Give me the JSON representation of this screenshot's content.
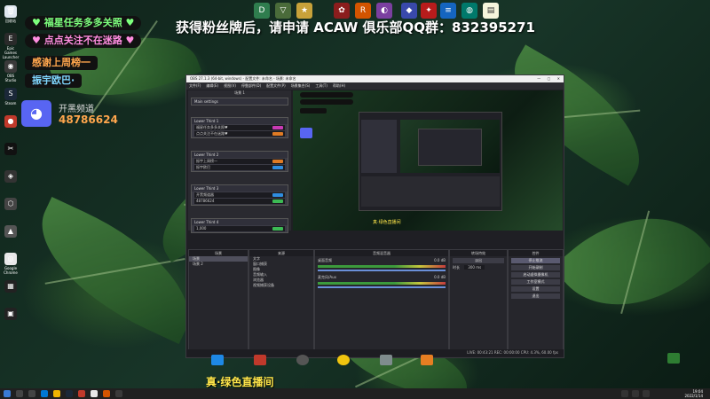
{
  "overlay": {
    "banner1": "♥ 福星任务多多关照 ♥",
    "banner2": "♥ 点点关注不在迷路 ♥",
    "thanks": "感谢上周榜一",
    "thanks_name": "振宇欧巴·",
    "discord_label": "开黑频道",
    "discord_id": "48786624",
    "top_title": "获得粉丝牌后，请申请 ACAW 俱乐部QQ群：832395271",
    "bottom_caption": "真·绿色直播间"
  },
  "desktop_icons": [
    {
      "name": "recycle-bin-icon",
      "label": "回收站",
      "color": "#dfe7ef",
      "glyph": "🗑"
    },
    {
      "name": "epic-games-icon",
      "label": "Epic Games Launcher",
      "color": "#2a2a2a",
      "glyph": "E"
    },
    {
      "name": "obs-desktop-icon",
      "label": "OBS Studio",
      "color": "#3a3a3a",
      "glyph": "◉"
    },
    {
      "name": "steam-icon",
      "label": "Steam",
      "color": "#1b2838",
      "glyph": "S"
    },
    {
      "name": "app-icon-1",
      "label": "",
      "color": "#c0392b",
      "glyph": "●"
    },
    {
      "name": "capcut-icon",
      "label": "",
      "color": "#111",
      "glyph": "✂"
    },
    {
      "name": "app-icon-2",
      "label": "",
      "color": "#333",
      "glyph": "◈"
    },
    {
      "name": "app-icon-3",
      "label": "",
      "color": "#444",
      "glyph": "⬡"
    },
    {
      "name": "app-icon-4",
      "label": "",
      "color": "#555",
      "glyph": "▲"
    },
    {
      "name": "chrome-icon",
      "label": "Google Chrome",
      "color": "#e8e8e8",
      "glyph": "◎"
    },
    {
      "name": "app-icon-5",
      "label": "",
      "color": "#222",
      "glyph": "▦"
    },
    {
      "name": "app-icon-6",
      "label": "",
      "color": "#222",
      "glyph": "▣"
    }
  ],
  "obs": {
    "titlebar": "OBS 27.1.3 (64-bit, windows) - 配置文件: 未命名 - 场景: 未命名",
    "menu": [
      "文件(F)",
      "编辑(E)",
      "视图(V)",
      "停靠部件(D)",
      "配置文件(P)",
      "场景集合(S)",
      "工具(T)",
      "帮助(H)"
    ],
    "scene_panel_title": "场景 1",
    "scene_blocks": [
      {
        "title": "Main settings",
        "rows": []
      },
      {
        "title": "Lower Third 1",
        "rows": [
          "福星任务多多关照♥",
          "点点关注不在迷路♥"
        ]
      },
      {
        "title": "Lower Third 2",
        "rows": [
          "振宇上周榜一",
          "振宇欧巴"
        ]
      },
      {
        "title": "Lower Third 3",
        "rows": [
          "开黑频道器",
          "48786624"
        ]
      },
      {
        "title": "Lower Third 4",
        "rows": [
          "1,000"
        ]
      }
    ],
    "scenes_header": "场景",
    "scenes": [
      "场景",
      "场景 2"
    ],
    "sources_header": "来源",
    "sources": [
      "文字",
      "窗口捕获",
      "图像",
      "音频输入",
      "浏览器",
      "视频捕获设备"
    ],
    "mixer_header": "音频混音器",
    "mixer_tracks": [
      {
        "name": "桌面音频",
        "db": "0.0 dB"
      },
      {
        "name": "麦克风/Aux",
        "db": "0.0 dB"
      }
    ],
    "transitions_header": "转场特效",
    "transition_value": "淡出",
    "duration_label": "时长",
    "duration_value": "300 ms",
    "controls_header": "控件",
    "controls": [
      "停止推流",
      "开始录制",
      "启动虚拟摄像机",
      "工作室模式",
      "设置",
      "退出"
    ],
    "status": "LIVE: 00:43:21   REC: 00:00:00   CPU: 4.3%, 60.00 fps"
  },
  "taskbar": {
    "time": "19:04",
    "date": "2022/1/14"
  }
}
